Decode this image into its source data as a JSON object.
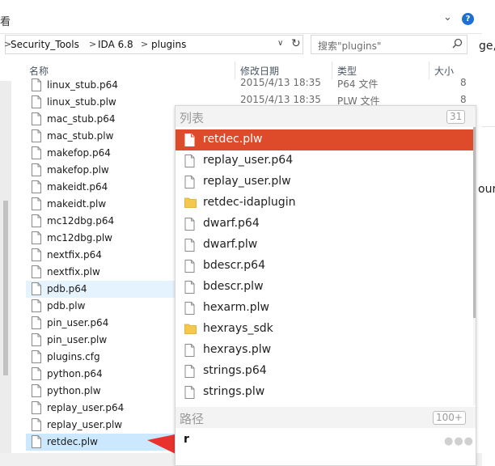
{
  "ribbon": {
    "partial_text": "看"
  },
  "address_bar": {
    "crumbs": [
      "Security_Tools",
      "IDA 6.8",
      "plugins"
    ],
    "separator": ">"
  },
  "search": {
    "placeholder": "搜索\"plugins\""
  },
  "edge_fragments": {
    "line1": "ge,",
    "line2": "our"
  },
  "columns": {
    "name": "名称",
    "date": "修改日期",
    "type": "类型",
    "size": "大小"
  },
  "files": [
    {
      "name": "linux_stub.p64",
      "date": "2015/4/13 18:35",
      "type": "P64 文件",
      "size": "8"
    },
    {
      "name": "linux_stub.plw",
      "date": "2015/4/13 18:35",
      "type": "PLW 文件",
      "size": "8"
    },
    {
      "name": "mac_stub.p64"
    },
    {
      "name": "mac_stub.plw"
    },
    {
      "name": "makefop.p64"
    },
    {
      "name": "makefop.plw"
    },
    {
      "name": "makeidt.p64"
    },
    {
      "name": "makeidt.plw"
    },
    {
      "name": "mc12dbg.p64"
    },
    {
      "name": "mc12dbg.plw"
    },
    {
      "name": "nextfix.p64"
    },
    {
      "name": "nextfix.plw"
    },
    {
      "name": "pdb.p64"
    },
    {
      "name": "pdb.plw"
    },
    {
      "name": "pin_user.p64"
    },
    {
      "name": "pin_user.plw"
    },
    {
      "name": "plugins.cfg"
    },
    {
      "name": "python.p64"
    },
    {
      "name": "python.plw"
    },
    {
      "name": "replay_user.p64"
    },
    {
      "name": "replay_user.plw"
    },
    {
      "name": "retdec.plw"
    }
  ],
  "popup": {
    "list_title": "列表",
    "list_count": "31",
    "items": [
      {
        "label": "retdec.plw",
        "kind": "file"
      },
      {
        "label": "replay_user.p64",
        "kind": "file"
      },
      {
        "label": "replay_user.plw",
        "kind": "file"
      },
      {
        "label": "retdec-idaplugin",
        "kind": "folder"
      },
      {
        "label": "dwarf.p64",
        "kind": "file"
      },
      {
        "label": "dwarf.plw",
        "kind": "file"
      },
      {
        "label": "bdescr.p64",
        "kind": "file"
      },
      {
        "label": "bdescr.plw",
        "kind": "file"
      },
      {
        "label": "hexarm.plw",
        "kind": "file"
      },
      {
        "label": "hexrays_sdk",
        "kind": "folder"
      },
      {
        "label": "hexrays.plw",
        "kind": "file"
      },
      {
        "label": "strings.p64",
        "kind": "file"
      },
      {
        "label": "strings.plw",
        "kind": "file"
      }
    ],
    "path_title": "路径",
    "path_count": "100+",
    "query": "r",
    "colors": {
      "active_bg": "#dd4b2a",
      "folder": "#f2c94c"
    }
  },
  "annotation": {
    "arrow_color": "#e8322e"
  }
}
